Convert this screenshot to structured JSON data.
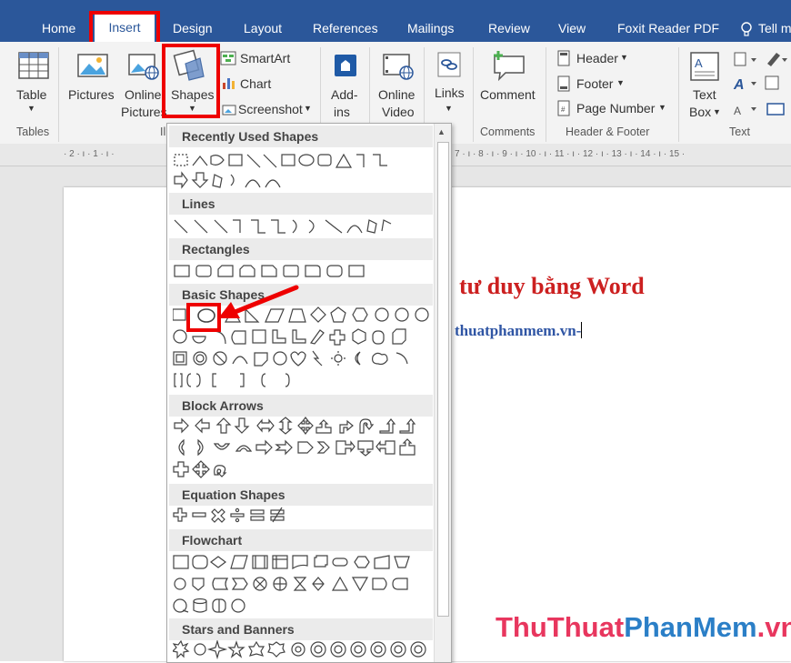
{
  "tabs": [
    "Home",
    "Insert",
    "Design",
    "Layout",
    "References",
    "Mailings",
    "Review",
    "View",
    "Foxit Reader PDF",
    "Tell m"
  ],
  "ribbon": {
    "table": "Table",
    "pictures": "Pictures",
    "online_pictures_1": "Online",
    "online_pictures_2": "Pictures",
    "shapes": "Shapes",
    "smartart": "SmartArt",
    "chart": "Chart",
    "screenshot": "Screenshot",
    "addins_1": "Add-",
    "addins_2": "ins",
    "online_video_1": "Online",
    "online_video_2": "Video",
    "links": "Links",
    "comment": "Comment",
    "header": "Header",
    "footer": "Footer",
    "page_number": "Page Number",
    "text_box_1": "Text",
    "text_box_2": "Box",
    "groups": {
      "tables": "Tables",
      "illustrations": "Ill",
      "comments": "Comments",
      "header_footer": "Header & Footer",
      "text": "Text"
    }
  },
  "ruler_left": "· 2 · ı · 1 · ı ·",
  "ruler_right": "7 · ı · 8 · ı · 9 · ı · 10 · ı · 11 · ı · 12 · ı · 13 · ı · 14 · ı · 15 ·",
  "document": {
    "title": "tư duy bằng Word",
    "subtitle": "thuatphanmem.vn-"
  },
  "gallery": {
    "sections": [
      "Recently Used Shapes",
      "Lines",
      "Rectangles",
      "Basic Shapes",
      "Block Arrows",
      "Equation Shapes",
      "Flowchart",
      "Stars and Banners"
    ]
  },
  "watermark": {
    "a": "ThuThuat",
    "b": "PhanMem",
    "c": ".vn"
  },
  "colors": {
    "tab_bar": "#2b579a",
    "highlight": "#e00000",
    "title": "#cc2020",
    "subtitle": "#2f55a4"
  }
}
